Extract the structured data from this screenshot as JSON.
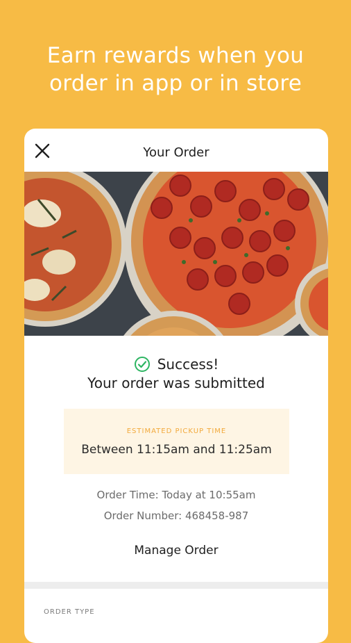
{
  "promo": {
    "headline_line1": "Earn rewards when you",
    "headline_line2": "order in app or in store"
  },
  "header": {
    "title": "Your Order",
    "close_icon": "close-icon"
  },
  "confirmation": {
    "status_icon": "check-circle-icon",
    "status_text": "Success!",
    "message": "Your order was submitted"
  },
  "pickup": {
    "label": "ESTIMATED PICKUP TIME",
    "value": "Between 11:15am and 11:25am"
  },
  "details": {
    "order_time": "Order Time: Today at 10:55am",
    "order_number": "Order Number: 468458-987"
  },
  "actions": {
    "manage_order": "Manage Order"
  },
  "summary": {
    "order_type_label": "ORDER TYPE"
  },
  "colors": {
    "background": "#F7BB45",
    "success_green": "#2DB562",
    "pickup_accent": "#F2A93B"
  }
}
